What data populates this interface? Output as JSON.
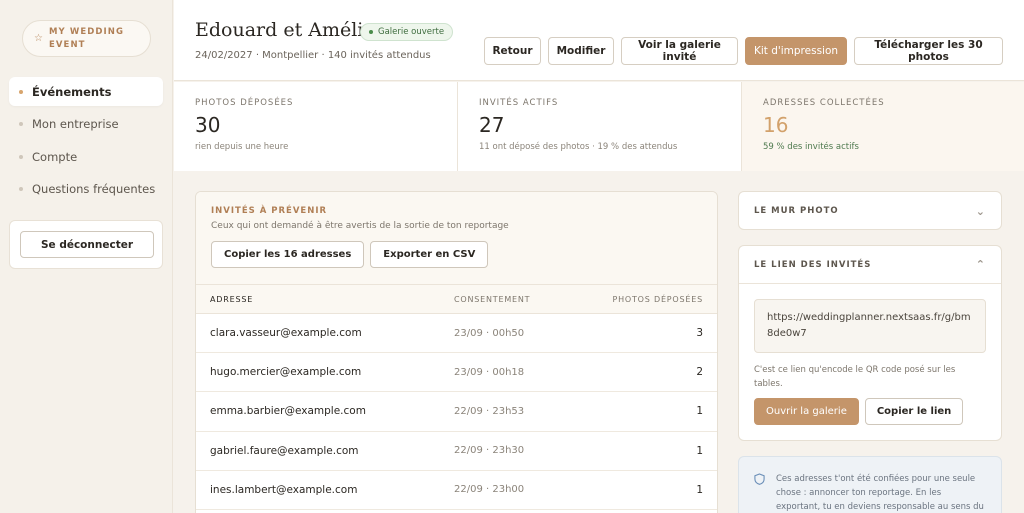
{
  "sidebar": {
    "brand": "MY WEDDING EVENT",
    "items": [
      {
        "label": "Événements"
      },
      {
        "label": "Mon entreprise"
      },
      {
        "label": "Compte"
      },
      {
        "label": "Questions fréquentes"
      }
    ],
    "logout_label": "Se déconnecter"
  },
  "header": {
    "title": "Edouard et Amélie",
    "status_badge": "Galerie ouverte",
    "subtitle": "24/02/2027 · Montpellier · 140 invités attendus",
    "buttons": {
      "back": "Retour",
      "edit": "Modifier",
      "view_gallery": "Voir la galerie invité",
      "print_kit": "Kit d'impression",
      "download": "Télécharger les 30 photos"
    }
  },
  "stats": [
    {
      "label": "PHOTOS DÉPOSÉES",
      "value": "30",
      "note": "rien depuis une heure"
    },
    {
      "label": "INVITÉS ACTIFS",
      "value": "27",
      "note": "11 ont déposé des photos · 19 % des attendus"
    },
    {
      "label": "ADRESSES COLLECTÉES",
      "value": "16",
      "note": "59 % des invités actifs"
    }
  ],
  "guests": {
    "heading": "INVITÉS À PRÉVENIR",
    "description": "Ceux qui ont demandé à être avertis de la sortie de ton reportage",
    "copy_button": "Copier les 16 adresses",
    "export_button": "Exporter en CSV",
    "columns": [
      "ADRESSE",
      "CONSENTEMENT",
      "PHOTOS DÉPOSÉES"
    ],
    "rows": [
      {
        "email": "clara.vasseur@example.com",
        "consent": "23/09 · 00h50",
        "photos": "3"
      },
      {
        "email": "hugo.mercier@example.com",
        "consent": "23/09 · 00h18",
        "photos": "2"
      },
      {
        "email": "emma.barbier@example.com",
        "consent": "22/09 · 23h53",
        "photos": "1"
      },
      {
        "email": "gabriel.faure@example.com",
        "consent": "22/09 · 23h30",
        "photos": "1"
      },
      {
        "email": "ines.lambert@example.com",
        "consent": "22/09 · 23h00",
        "photos": "1"
      }
    ]
  },
  "photo_wall": {
    "heading": "LE MUR PHOTO"
  },
  "guest_link": {
    "heading": "LE LIEN DES INVITÉS",
    "url": "https://weddingplanner.nextsaas.fr/g/bm8de0w7",
    "note": "C'est ce lien qu'encode le QR code posé sur les tables.",
    "open_button": "Ouvrir la galerie",
    "copy_button": "Copier le lien"
  },
  "info_note": "Ces adresses t'ont été confiées pour une seule chose : annoncer ton reportage. En les exportant, tu en deviens responsable au sens du",
  "colors": {
    "accent": "#c4956a",
    "highlight": "#d2a16b",
    "success": "#4a8c4a"
  }
}
